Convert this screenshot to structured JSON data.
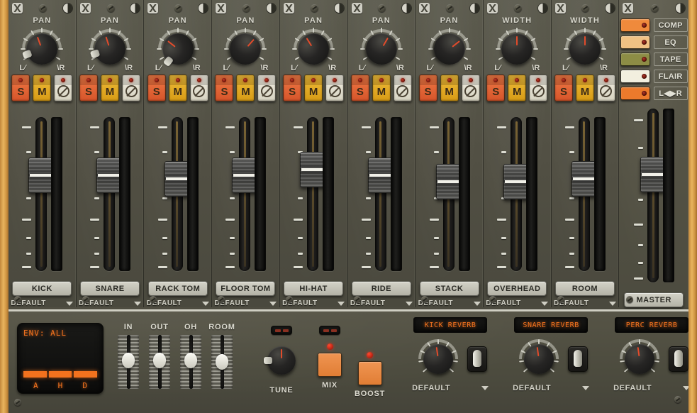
{
  "channels": [
    {
      "name": "KICK",
      "knob_label": "PAN",
      "preset": "DEFAULT",
      "pan_deg": -20,
      "fader_pct": 62,
      "has_grip": true
    },
    {
      "name": "SNARE",
      "knob_label": "PAN",
      "preset": "DEFAULT",
      "pan_deg": -18,
      "fader_pct": 62,
      "has_grip": true
    },
    {
      "name": "RACK TOM",
      "knob_label": "PAN",
      "preset": "DEFAULT",
      "pan_deg": -52,
      "fader_pct": 60,
      "has_grip": true
    },
    {
      "name": "FLOOR TOM",
      "knob_label": "PAN",
      "preset": "DEFAULT",
      "pan_deg": 42,
      "fader_pct": 62,
      "has_grip": false
    },
    {
      "name": "HI-HAT",
      "knob_label": "PAN",
      "preset": "DEFAULT",
      "pan_deg": -32,
      "fader_pct": 66,
      "has_grip": false
    },
    {
      "name": "RIDE",
      "knob_label": "PAN",
      "preset": "DEFAULT",
      "pan_deg": 30,
      "fader_pct": 62,
      "has_grip": false
    },
    {
      "name": "STACK",
      "knob_label": "PAN",
      "preset": "DEFAULT",
      "pan_deg": 52,
      "fader_pct": 58,
      "has_grip": false
    },
    {
      "name": "OVERHEAD",
      "knob_label": "WIDTH",
      "preset": "DEFAULT",
      "pan_deg": 0,
      "fader_pct": 58,
      "has_grip": false
    },
    {
      "name": "ROOM",
      "knob_label": "WIDTH",
      "preset": "DEFAULT",
      "pan_deg": 0,
      "fader_pct": 60,
      "has_grip": false
    }
  ],
  "strip_buttons": {
    "solo": "S",
    "mute": "M",
    "disable_icon": "no-entry-icon"
  },
  "pan_scale": {
    "left": "L",
    "right": "R"
  },
  "master": {
    "name": "MASTER",
    "fader_pct": 62,
    "toggles": [
      {
        "label": "COMP",
        "color": "#ef8a3c"
      },
      {
        "label": "EQ",
        "color": "#f0c184"
      },
      {
        "label": "TAPE",
        "color": "#8d8d45"
      },
      {
        "label": "FLAIR",
        "color": "#f2efdf"
      },
      {
        "label": "L◀▶R",
        "color": "#ec7a2c"
      }
    ]
  },
  "bottom": {
    "env_display": {
      "title": "ENV: ALL",
      "labels": [
        "A",
        "H",
        "D"
      ],
      "color": "#f2721e"
    },
    "sliders": [
      {
        "label": "IN",
        "value_pct": 52
      },
      {
        "label": "OUT",
        "value_pct": 52
      },
      {
        "label": "OH",
        "value_pct": 52
      },
      {
        "label": "ROOM",
        "value_pct": 50
      }
    ],
    "tune": {
      "label": "TUNE",
      "angle_deg": 0
    },
    "mix": {
      "label": "MIX",
      "led_on": true
    },
    "boost": {
      "label": "BOOST",
      "led_on": true
    },
    "reverbs": [
      {
        "title": "KICK REVERB",
        "preset": "DEFAULT",
        "angle_deg": -8
      },
      {
        "title": "SNARE REVERB",
        "preset": "DEFAULT",
        "angle_deg": -8
      },
      {
        "title": "PERC REVERB",
        "preset": "DEFAULT",
        "angle_deg": -8
      }
    ]
  }
}
